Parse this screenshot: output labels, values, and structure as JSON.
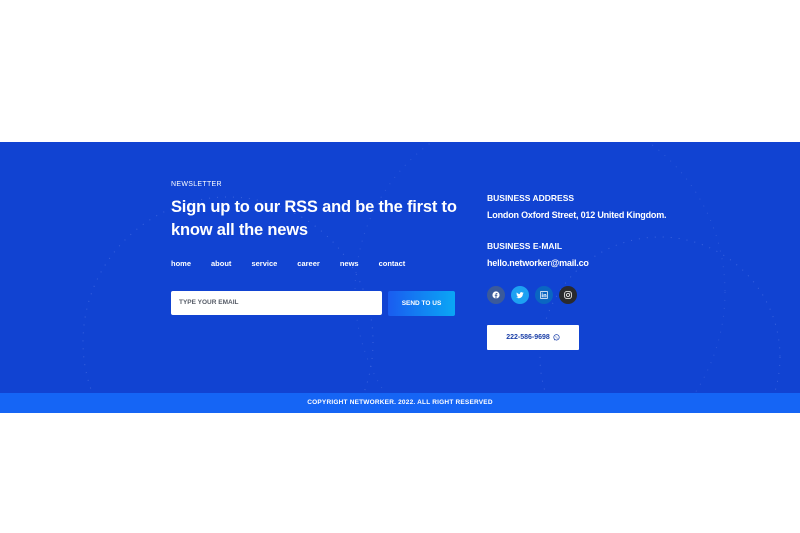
{
  "newsletter": {
    "label": "NEWSLETTER",
    "headline": "Sign up to our RSS and be the first to know all the news",
    "email_placeholder": "TYPE YOUR EMAIL",
    "send_label": "SEND TO US"
  },
  "nav": {
    "items": [
      "home",
      "about",
      "service",
      "career",
      "news",
      "contact"
    ]
  },
  "contact": {
    "address_title": "BUSINESS ADDRESS",
    "address_value": "London Oxford Street, 012 United Kingdom.",
    "email_title": "BUSINESS E-MAIL",
    "email_value": "hello.networker@mail.co",
    "phone": "222-586-9698"
  },
  "social": [
    {
      "icon": "facebook-icon",
      "color": "#3b5a9a"
    },
    {
      "icon": "twitter-icon",
      "color": "#1da1f2"
    },
    {
      "icon": "linkedin-icon",
      "color": "#0a66c2"
    },
    {
      "icon": "instagram-icon",
      "color": "#2a2a2e"
    }
  ],
  "footer": {
    "copyright": "COPYRIGHT NETWORKER. 2022. ALL RIGHT RESERVED"
  },
  "colors": {
    "footer_bg": "#1143d2",
    "copyright_bg": "#1565f5",
    "accent_gradient_start": "#1a5cf0",
    "accent_gradient_end": "#0aa7f5"
  }
}
